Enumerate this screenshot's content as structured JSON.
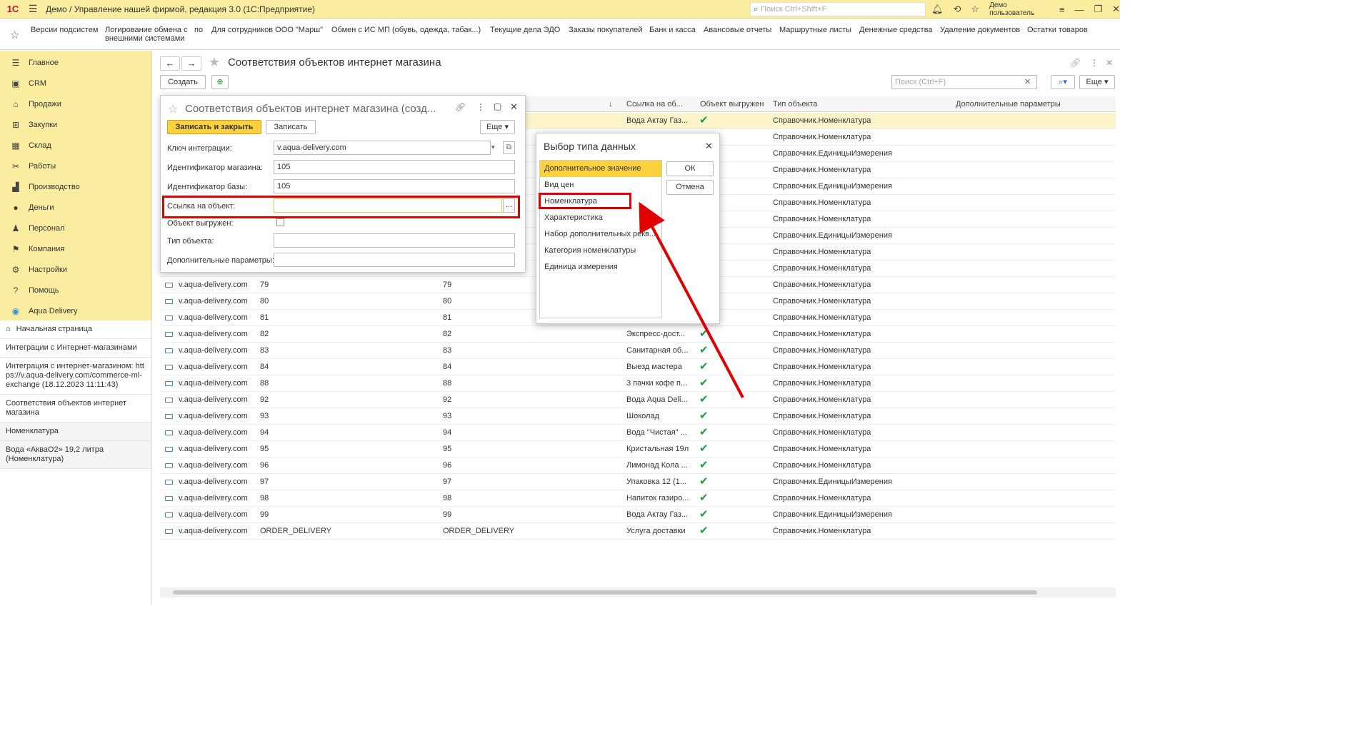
{
  "titlebar": {
    "logo": "1С",
    "app_title": "Демо / Управление нашей фирмой, редакция 3.0  (1С:Предприятие)",
    "search_placeholder": "Поиск Ctrl+Shift+F",
    "user": "Демо пользователь"
  },
  "favorites": [
    "Версии подсистем",
    "Логирование обмена с внешними системами",
    "по",
    "Для сотрудников ООО \"Марш\"",
    "Обмен с ИС МП (обувь, одежда, табак...)",
    "Текущие дела ЭДО",
    "Заказы покупателей",
    "Банк и касса",
    "Авансовые отчеты",
    "Маршрутные листы",
    "Денежные средства",
    "Удаление документов",
    "Остатки товаров"
  ],
  "sidebar": {
    "sections": [
      {
        "label": "Главное",
        "icon": "menu-icon"
      },
      {
        "label": "CRM",
        "icon": "crm-icon"
      },
      {
        "label": "Продажи",
        "icon": "basket-icon"
      },
      {
        "label": "Закупки",
        "icon": "purchases-icon"
      },
      {
        "label": "Склад",
        "icon": "warehouse-icon"
      },
      {
        "label": "Работы",
        "icon": "tools-icon"
      },
      {
        "label": "Производство",
        "icon": "factory-icon"
      },
      {
        "label": "Деньги",
        "icon": "money-icon"
      },
      {
        "label": "Персонал",
        "icon": "people-icon"
      },
      {
        "label": "Компания",
        "icon": "flag-icon"
      },
      {
        "label": "Настройки",
        "icon": "gear-icon"
      },
      {
        "label": "Помощь",
        "icon": "help-icon"
      },
      {
        "label": "Aqua Delivery",
        "icon": "drop-icon"
      }
    ],
    "history": [
      "Начальная страница",
      "Интеграции с Интернет-магазинами",
      "Интеграция с интернет-магазином: https://v.aqua-delivery.com/commerce-ml-exchange (18.12.2023 11:11:43)",
      "Соответствия объектов интернет магазина",
      "Номенклатура",
      "Вода «АкваО2» 19,2 литра (Номенклатура)"
    ]
  },
  "main": {
    "title": "Соответствия объектов интернет магазина",
    "create_button": "Создать",
    "search_placeholder": "Поиск (Ctrl+F)",
    "more_button": "Еще",
    "columns": {
      "sort_arrow": "↓",
      "link": "Ссылка на об...",
      "exported": "Объект выгружен",
      "type": "Тип объекта",
      "params": "Дополнительные параметры"
    },
    "top_rows": [
      {
        "link": "Вода Актау Газ...",
        "exported": true,
        "type": "Справочник.Номенклатура"
      },
      {
        "link": "",
        "exported": true,
        "type": "Справочник.Номенклатура"
      },
      {
        "link": "",
        "exported": false,
        "type": "Справочник.ЕдиницыИзмерения"
      },
      {
        "link": "",
        "exported": false,
        "type": "Справочник.Номенклатура"
      },
      {
        "link": "",
        "exported": false,
        "type": "Справочник.ЕдиницыИзмерения"
      },
      {
        "link": "",
        "exported": false,
        "type": "Справочник.Номенклатура"
      },
      {
        "link": "",
        "exported": false,
        "type": "Справочник.Номенклатура"
      },
      {
        "link": "",
        "exported": false,
        "type": "Справочник.ЕдиницыИзмерения"
      },
      {
        "link": "",
        "exported": false,
        "type": "Справочник.Номенклатура"
      },
      {
        "link": "",
        "exported": false,
        "type": "Справочник.Номенклатура"
      }
    ],
    "rows": [
      {
        "key": "v.aqua-delivery.com",
        "shop_id": "79",
        "base_id": "79",
        "link": "",
        "exported": false,
        "type": "Справочник.Номенклатура"
      },
      {
        "key": "v.aqua-delivery.com",
        "shop_id": "80",
        "base_id": "80",
        "link": "",
        "exported": false,
        "type": "Справочник.Номенклатура"
      },
      {
        "key": "v.aqua-delivery.com",
        "shop_id": "81",
        "base_id": "81",
        "link": "",
        "exported": false,
        "type": "Справочник.Номенклатура"
      },
      {
        "key": "v.aqua-delivery.com",
        "shop_id": "82",
        "base_id": "82",
        "link": "Экспресс-дост...",
        "exported": true,
        "type": "Справочник.Номенклатура"
      },
      {
        "key": "v.aqua-delivery.com",
        "shop_id": "83",
        "base_id": "83",
        "link": "Санитарная об...",
        "exported": true,
        "type": "Справочник.Номенклатура"
      },
      {
        "key": "v.aqua-delivery.com",
        "shop_id": "84",
        "base_id": "84",
        "link": "Выезд мастера",
        "exported": true,
        "type": "Справочник.Номенклатура"
      },
      {
        "key": "v.aqua-delivery.com",
        "shop_id": "88",
        "base_id": "88",
        "link": "3 пачки кофе п...",
        "exported": true,
        "type": "Справочник.Номенклатура"
      },
      {
        "key": "v.aqua-delivery.com",
        "shop_id": "92",
        "base_id": "92",
        "link": "Вода Aqua Deli...",
        "exported": true,
        "type": "Справочник.Номенклатура"
      },
      {
        "key": "v.aqua-delivery.com",
        "shop_id": "93",
        "base_id": "93",
        "link": "Шоколад",
        "exported": true,
        "type": "Справочник.Номенклатура"
      },
      {
        "key": "v.aqua-delivery.com",
        "shop_id": "94",
        "base_id": "94",
        "link": "Вода \"Чистая\" ...",
        "exported": true,
        "type": "Справочник.Номенклатура"
      },
      {
        "key": "v.aqua-delivery.com",
        "shop_id": "95",
        "base_id": "95",
        "link": "Кристальная 19л",
        "exported": true,
        "type": "Справочник.Номенклатура"
      },
      {
        "key": "v.aqua-delivery.com",
        "shop_id": "96",
        "base_id": "96",
        "link": "Лимонад Кола ...",
        "exported": true,
        "type": "Справочник.Номенклатура"
      },
      {
        "key": "v.aqua-delivery.com",
        "shop_id": "97",
        "base_id": "97",
        "link": "Упаковка 12 (1...",
        "exported": true,
        "type": "Справочник.ЕдиницыИзмерения"
      },
      {
        "key": "v.aqua-delivery.com",
        "shop_id": "98",
        "base_id": "98",
        "link": "Напиток газиро...",
        "exported": true,
        "type": "Справочник.Номенклатура"
      },
      {
        "key": "v.aqua-delivery.com",
        "shop_id": "99",
        "base_id": "99",
        "link": "Вода Актау Газ...",
        "exported": true,
        "type": "Справочник.ЕдиницыИзмерения"
      },
      {
        "key": "v.aqua-delivery.com",
        "shop_id": "ORDER_DELIVERY",
        "base_id": "ORDER_DELIVERY",
        "link": "Услуга доставки",
        "exported": true,
        "type": "Справочник.Номенклатура"
      }
    ]
  },
  "form": {
    "title": "Соответствия объектов интернет магазина (созд...",
    "save_close": "Записать и закрыть",
    "save": "Записать",
    "more": "Еще",
    "fields": {
      "key_label": "Ключ интеграции:",
      "key_value": "v.aqua-delivery.com",
      "shop_label": "Идентификатор магазина:",
      "shop_value": "105",
      "base_label": "Идентификатор базы:",
      "base_value": "105",
      "link_label": "Ссылка на объект:",
      "link_value": "",
      "exported_label": "Объект выгружен:",
      "type_label": "Тип объекта:",
      "type_value": "",
      "params_label": "Дополнительные параметры:",
      "params_value": "",
      "ellipsis": "..."
    }
  },
  "dialog": {
    "title": "Выбор типа данных",
    "items": [
      "Дополнительное значение",
      "Вид цен",
      "Номенклатура",
      "Характеристика",
      "Набор дополнительных рекв...",
      "Категория номенклатуры",
      "Единица измерения"
    ],
    "selected_index": 0,
    "ok": "ОК",
    "cancel": "Отмена"
  },
  "colors": {
    "accent_yellow": "#fbd23d",
    "panel_yellow": "#fbeda0",
    "highlight_red": "#e00000",
    "check_green": "#1d9c42"
  }
}
